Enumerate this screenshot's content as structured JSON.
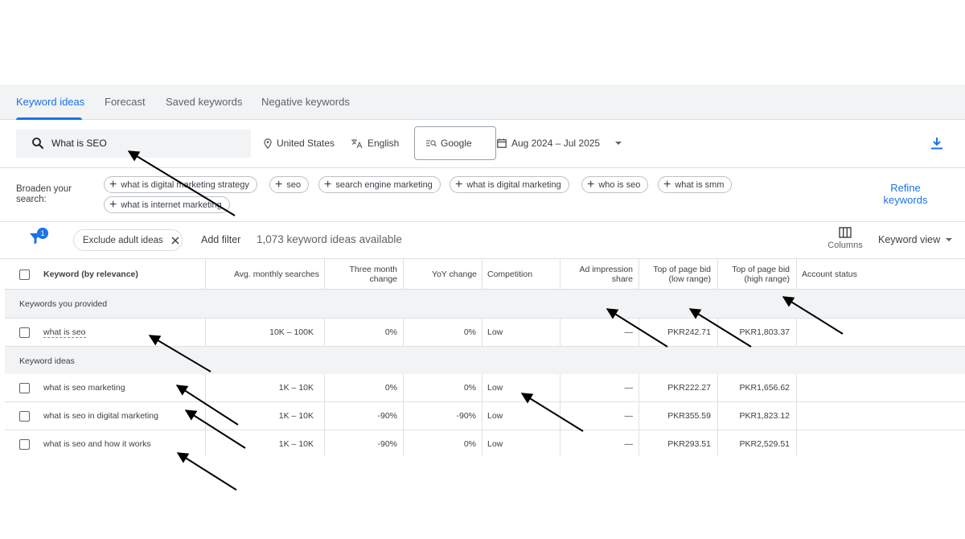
{
  "tabs": [
    {
      "label": "Keyword ideas",
      "active": true
    },
    {
      "label": "Forecast"
    },
    {
      "label": "Saved keywords"
    },
    {
      "label": "Negative keywords"
    }
  ],
  "search": {
    "query": "What is SEO",
    "location": "United States",
    "language": "English",
    "network": "Google",
    "date_range": "Aug 2024 – Jul 2025"
  },
  "broaden": {
    "label": "Broaden your search:",
    "chips": [
      "what is digital marketing strategy",
      "seo",
      "search engine marketing",
      "what is digital marketing",
      "who is seo",
      "what is smm",
      "what is internet marketing"
    ],
    "refine": "Refine keywords"
  },
  "toolbar": {
    "filter_count": "1",
    "exclude_chip": "Exclude adult ideas",
    "add_filter": "Add filter",
    "available": "1,073 keyword ideas available",
    "columns_label": "Columns",
    "view_label": "Keyword view"
  },
  "table": {
    "headers": {
      "keyword": "Keyword (by relevance)",
      "avg": "Avg. monthly searches",
      "three_l1": "Three month",
      "three_l2": "change",
      "yoy": "YoY change",
      "competition": "Competition",
      "ad_l1": "Ad impression",
      "ad_l2": "share",
      "low_l1": "Top of page bid",
      "low_l2": "(low range)",
      "high_l1": "Top of page bid",
      "high_l2": "(high range)",
      "status": "Account status"
    },
    "group_provided": "Keywords you provided",
    "group_ideas": "Keyword ideas",
    "provided": [
      {
        "keyword": "what is seo",
        "avg": "10K – 100K",
        "three": "0%",
        "yoy": "0%",
        "competition": "Low",
        "ad": "—",
        "low": "PKR242.71",
        "high": "PKR1,803.37"
      }
    ],
    "ideas": [
      {
        "keyword": "what is seo marketing",
        "avg": "1K – 10K",
        "three": "0%",
        "yoy": "0%",
        "competition": "Low",
        "ad": "—",
        "low": "PKR222.27",
        "high": "PKR1,656.62"
      },
      {
        "keyword": "what is seo in digital marketing",
        "avg": "1K – 10K",
        "three": "-90%",
        "yoy": "-90%",
        "competition": "Low",
        "ad": "—",
        "low": "PKR355.59",
        "high": "PKR1,823.12"
      },
      {
        "keyword": "what is seo and how it works",
        "avg": "1K – 10K",
        "three": "-90%",
        "yoy": "0%",
        "competition": "Low",
        "ad": "—",
        "low": "PKR293.51",
        "high": "PKR2,529.51"
      }
    ]
  },
  "icons": [
    "search-icon",
    "location-pin-icon",
    "translate-icon",
    "search-network-icon",
    "calendar-icon",
    "dropdown-arrow-icon",
    "download-icon",
    "plus-icon",
    "filter-icon",
    "close-icon",
    "columns-icon",
    "checkbox-icon",
    "annotation-arrow-icon"
  ],
  "colors": {
    "accent": "#1a73e8",
    "tab_bar": "#f1f3f4",
    "group_row": "#f1f3f4",
    "arrow": "#000000"
  }
}
